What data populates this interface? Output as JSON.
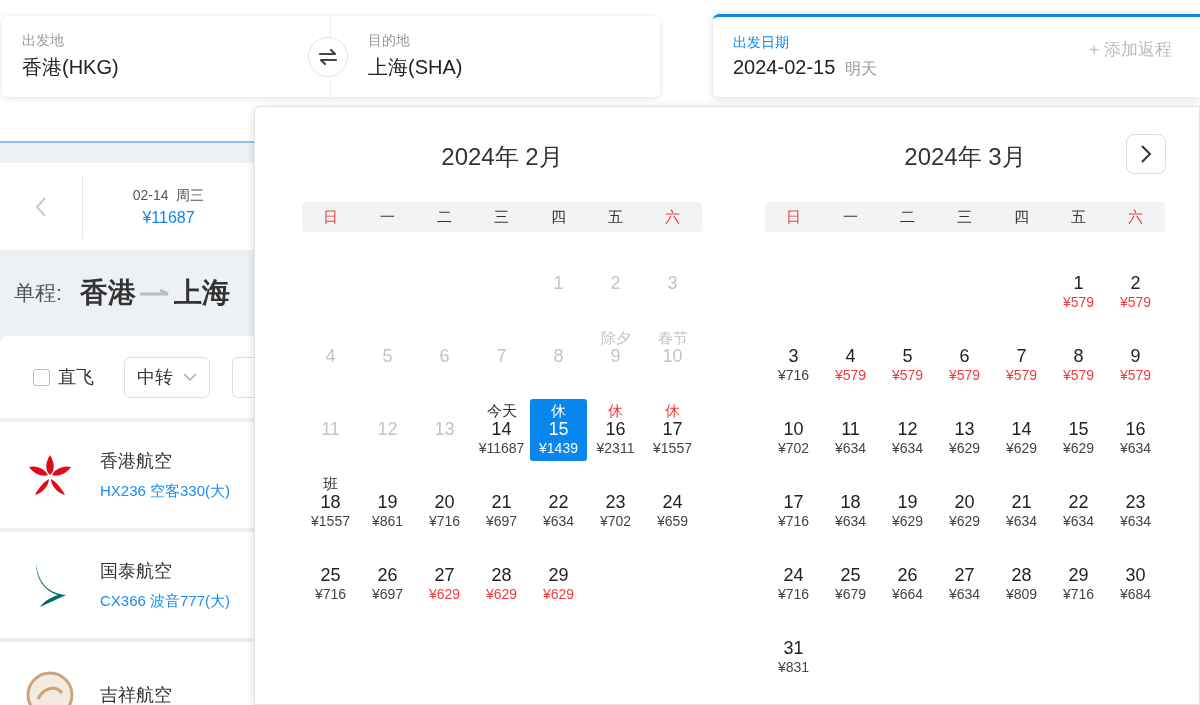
{
  "search": {
    "origin": {
      "label": "出发地",
      "value": "香港(HKG)"
    },
    "destination": {
      "label": "目的地",
      "value": "上海(SHA)"
    },
    "date": {
      "label": "出发日期",
      "value": "2024-02-15",
      "note": "明天"
    },
    "add_return": "+ 添加返程"
  },
  "date_strip": [
    {
      "date": "02-14",
      "weekday": "周三",
      "price": "¥11687",
      "selected": false
    }
  ],
  "route": {
    "label": "单程:",
    "from": "香港",
    "to": "上海"
  },
  "filters": [
    {
      "kind": "checkbox",
      "label": "直飞",
      "checked": false
    },
    {
      "kind": "dropdown",
      "label": "中转"
    },
    {
      "kind": "dropdown"
    }
  ],
  "flights": [
    {
      "kind": "flower",
      "airline": "香港航空",
      "flight": "HX236 空客330(大)"
    },
    {
      "kind": "wing",
      "airline": "国泰航空",
      "flight": "CX366 波音777(大)"
    },
    {
      "kind": "emblem",
      "airline": "吉祥航空"
    }
  ],
  "calendar": {
    "months": [
      {
        "title": "2024年 2月",
        "weekdays": [
          {
            "label": "日",
            "weekend": true
          },
          {
            "label": "一",
            "weekend": false
          },
          {
            "label": "二",
            "weekend": false
          },
          {
            "label": "三",
            "weekend": false
          },
          {
            "label": "四",
            "weekend": false
          },
          {
            "label": "五",
            "weekend": false
          },
          {
            "label": "六",
            "weekend": true
          }
        ],
        "days": [
          {
            "kind": "blank"
          },
          {
            "kind": "blank"
          },
          {
            "kind": "blank"
          },
          {
            "kind": "blank"
          },
          {
            "kind": "day",
            "day": "1",
            "disabled": true,
            "selected": false
          },
          {
            "kind": "day",
            "day": "2",
            "disabled": true,
            "selected": false
          },
          {
            "kind": "day",
            "day": "3",
            "disabled": true,
            "selected": false
          },
          {
            "kind": "day",
            "day": "4",
            "disabled": true,
            "selected": false
          },
          {
            "kind": "day",
            "day": "5",
            "disabled": true,
            "selected": false
          },
          {
            "kind": "day",
            "day": "6",
            "disabled": true,
            "selected": false
          },
          {
            "kind": "day",
            "day": "7",
            "disabled": true,
            "selected": false
          },
          {
            "kind": "day",
            "day": "8",
            "disabled": true,
            "selected": false
          },
          {
            "kind": "day",
            "day": "9",
            "note": "除夕",
            "rest": false,
            "disabled": true,
            "selected": false
          },
          {
            "kind": "day",
            "day": "10",
            "note": "春节",
            "rest": false,
            "disabled": true,
            "selected": false
          },
          {
            "kind": "day",
            "day": "11",
            "disabled": true,
            "selected": false
          },
          {
            "kind": "day",
            "day": "12",
            "disabled": true,
            "selected": false
          },
          {
            "kind": "day",
            "day": "13",
            "disabled": true,
            "selected": false
          },
          {
            "kind": "day",
            "day": "14",
            "note": "今天",
            "rest": false,
            "price": "¥11687",
            "disabled": false,
            "selected": false,
            "low": false
          },
          {
            "kind": "day",
            "day": "15",
            "note": "休",
            "rest": true,
            "price": "¥1439",
            "disabled": false,
            "selected": true,
            "low": false
          },
          {
            "kind": "day",
            "day": "16",
            "note": "休",
            "rest": true,
            "price": "¥2311",
            "disabled": false,
            "selected": false,
            "low": false
          },
          {
            "kind": "day",
            "day": "17",
            "note": "休",
            "rest": true,
            "price": "¥1557",
            "disabled": false,
            "selected": false,
            "low": false
          },
          {
            "kind": "day",
            "day": "18",
            "note": "班",
            "rest": false,
            "price": "¥1557",
            "disabled": false,
            "selected": false,
            "low": false
          },
          {
            "kind": "day",
            "day": "19",
            "price": "¥861",
            "disabled": false,
            "selected": false,
            "low": false
          },
          {
            "kind": "day",
            "day": "20",
            "price": "¥716",
            "disabled": false,
            "selected": false,
            "low": false
          },
          {
            "kind": "day",
            "day": "21",
            "price": "¥697",
            "disabled": false,
            "selected": false,
            "low": false
          },
          {
            "kind": "day",
            "day": "22",
            "price": "¥634",
            "disabled": false,
            "selected": false,
            "low": false
          },
          {
            "kind": "day",
            "day": "23",
            "price": "¥702",
            "disabled": false,
            "selected": false,
            "low": false
          },
          {
            "kind": "day",
            "day": "24",
            "price": "¥659",
            "disabled": false,
            "selected": false,
            "low": false
          },
          {
            "kind": "day",
            "day": "25",
            "price": "¥716",
            "disabled": false,
            "selected": false,
            "low": false
          },
          {
            "kind": "day",
            "day": "26",
            "price": "¥697",
            "disabled": false,
            "selected": false,
            "low": false
          },
          {
            "kind": "day",
            "day": "27",
            "price": "¥629",
            "disabled": false,
            "selected": false,
            "low": true
          },
          {
            "kind": "day",
            "day": "28",
            "price": "¥629",
            "disabled": false,
            "selected": false,
            "low": true
          },
          {
            "kind": "day",
            "day": "29",
            "price": "¥629",
            "disabled": false,
            "selected": false,
            "low": true
          }
        ]
      },
      {
        "title": "2024年 3月",
        "weekdays": [
          {
            "label": "日",
            "weekend": true
          },
          {
            "label": "一",
            "weekend": false
          },
          {
            "label": "二",
            "weekend": false
          },
          {
            "label": "三",
            "weekend": false
          },
          {
            "label": "四",
            "weekend": false
          },
          {
            "label": "五",
            "weekend": false
          },
          {
            "label": "六",
            "weekend": true
          }
        ],
        "days": [
          {
            "kind": "blank"
          },
          {
            "kind": "blank"
          },
          {
            "kind": "blank"
          },
          {
            "kind": "blank"
          },
          {
            "kind": "blank"
          },
          {
            "kind": "day",
            "day": "1",
            "price": "¥579",
            "disabled": false,
            "selected": false,
            "low": true
          },
          {
            "kind": "day",
            "day": "2",
            "price": "¥579",
            "disabled": false,
            "selected": false,
            "low": true
          },
          {
            "kind": "day",
            "day": "3",
            "price": "¥716",
            "disabled": false,
            "selected": false,
            "low": false
          },
          {
            "kind": "day",
            "day": "4",
            "price": "¥579",
            "disabled": false,
            "selected": false,
            "low": true
          },
          {
            "kind": "day",
            "day": "5",
            "price": "¥579",
            "disabled": false,
            "selected": false,
            "low": true
          },
          {
            "kind": "day",
            "day": "6",
            "price": "¥579",
            "disabled": false,
            "selected": false,
            "low": true
          },
          {
            "kind": "day",
            "day": "7",
            "price": "¥579",
            "disabled": false,
            "selected": false,
            "low": true
          },
          {
            "kind": "day",
            "day": "8",
            "price": "¥579",
            "disabled": false,
            "selected": false,
            "low": true
          },
          {
            "kind": "day",
            "day": "9",
            "price": "¥579",
            "disabled": false,
            "selected": false,
            "low": true
          },
          {
            "kind": "day",
            "day": "10",
            "price": "¥702",
            "disabled": false,
            "selected": false,
            "low": false
          },
          {
            "kind": "day",
            "day": "11",
            "price": "¥634",
            "disabled": false,
            "selected": false,
            "low": false
          },
          {
            "kind": "day",
            "day": "12",
            "price": "¥634",
            "disabled": false,
            "selected": false,
            "low": false
          },
          {
            "kind": "day",
            "day": "13",
            "price": "¥629",
            "disabled": false,
            "selected": false,
            "low": false
          },
          {
            "kind": "day",
            "day": "14",
            "price": "¥629",
            "disabled": false,
            "selected": false,
            "low": false
          },
          {
            "kind": "day",
            "day": "15",
            "price": "¥629",
            "disabled": false,
            "selected": false,
            "low": false
          },
          {
            "kind": "day",
            "day": "16",
            "price": "¥634",
            "disabled": false,
            "selected": false,
            "low": false
          },
          {
            "kind": "day",
            "day": "17",
            "price": "¥716",
            "disabled": false,
            "selected": false,
            "low": false
          },
          {
            "kind": "day",
            "day": "18",
            "price": "¥634",
            "disabled": false,
            "selected": false,
            "low": false
          },
          {
            "kind": "day",
            "day": "19",
            "price": "¥629",
            "disabled": false,
            "selected": false,
            "low": false
          },
          {
            "kind": "day",
            "day": "20",
            "price": "¥629",
            "disabled": false,
            "selected": false,
            "low": false
          },
          {
            "kind": "day",
            "day": "21",
            "price": "¥634",
            "disabled": false,
            "selected": false,
            "low": false
          },
          {
            "kind": "day",
            "day": "22",
            "price": "¥634",
            "disabled": false,
            "selected": false,
            "low": false
          },
          {
            "kind": "day",
            "day": "23",
            "price": "¥634",
            "disabled": false,
            "selected": false,
            "low": false
          },
          {
            "kind": "day",
            "day": "24",
            "price": "¥716",
            "disabled": false,
            "selected": false,
            "low": false
          },
          {
            "kind": "day",
            "day": "25",
            "price": "¥679",
            "disabled": false,
            "selected": false,
            "low": false
          },
          {
            "kind": "day",
            "day": "26",
            "price": "¥664",
            "disabled": false,
            "selected": false,
            "low": false
          },
          {
            "kind": "day",
            "day": "27",
            "price": "¥634",
            "disabled": false,
            "selected": false,
            "low": false
          },
          {
            "kind": "day",
            "day": "28",
            "price": "¥809",
            "disabled": false,
            "selected": false,
            "low": false
          },
          {
            "kind": "day",
            "day": "29",
            "price": "¥716",
            "disabled": false,
            "selected": false,
            "low": false
          },
          {
            "kind": "day",
            "day": "30",
            "price": "¥684",
            "disabled": false,
            "selected": false,
            "low": false
          },
          {
            "kind": "day",
            "day": "31",
            "price": "¥831",
            "disabled": false,
            "selected": false,
            "low": false
          }
        ]
      }
    ]
  }
}
